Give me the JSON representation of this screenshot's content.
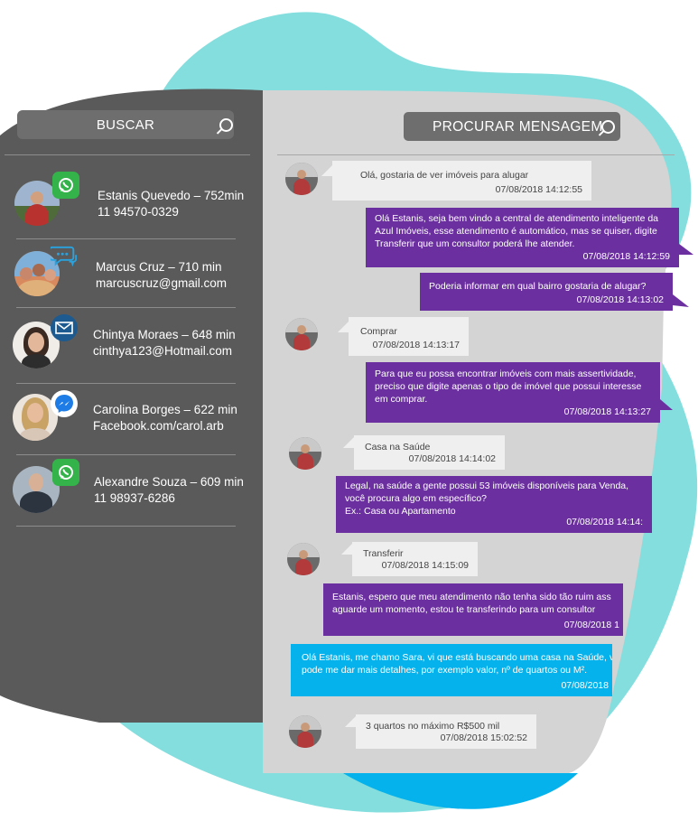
{
  "sidebar": {
    "search_label": "BUSCAR",
    "contacts": [
      {
        "name": "Estanis Quevedo – 752min",
        "detail": "11 94570-0329",
        "channel": "whatsapp-icon",
        "channel_color": "#34b34a"
      },
      {
        "name": "Marcus Cruz – 710 min",
        "detail": "marcuscruz@gmail.com",
        "channel": "chat-bubbles-icon",
        "channel_color": "#29a3e0"
      },
      {
        "name": "Chintya Moraes – 648 min",
        "detail": "cinthya123@Hotmail.com",
        "channel": "email-icon",
        "channel_color": "#1c5a8f"
      },
      {
        "name": "Carolina Borges – 622 min",
        "detail": "Facebook.com/carol.arb",
        "channel": "messenger-icon",
        "channel_color": "#1e7ce6"
      },
      {
        "name": "Alexandre Souza – 609 min",
        "detail": "11 98937-6286",
        "channel": "whatsapp-icon",
        "channel_color": "#34b34a"
      }
    ]
  },
  "chat": {
    "search_label": "PROCURAR MENSAGEM",
    "messages": [
      {
        "from": "customer",
        "text": "Olá, gostaria de ver imóveis para alugar",
        "time": "07/08/2018 14:12:55"
      },
      {
        "from": "bot",
        "text": "Olá Estanis, seja bem vindo a central de atendimento inteligente da Azul Imóveis, esse atendimento é automático, mas se quiser, digite Transferir que um consultor poderá lhe atender.",
        "time": "07/08/2018 14:12:59"
      },
      {
        "from": "bot",
        "text": "Poderia informar em qual bairro gostaria de alugar?",
        "time": "07/08/2018 14:13:02"
      },
      {
        "from": "customer",
        "text": "Comprar",
        "time": "07/08/2018 14:13:17"
      },
      {
        "from": "bot",
        "text": "Para que eu possa encontrar imóveis com mais assertividade, preciso que digite apenas o tipo de imóvel que possui interesse em comprar.",
        "time": "07/08/2018 14:13:27"
      },
      {
        "from": "customer",
        "text": "Casa na Saúde",
        "time": "07/08/2018 14:14:02"
      },
      {
        "from": "bot",
        "text": "Legal, na saúde a gente possui 53 imóveis disponíveis para Venda, você procura algo em específico?",
        "text2": "Ex.: Casa ou Apartamento",
        "time": "07/08/2018 14:14:"
      },
      {
        "from": "customer",
        "text": "Transferir",
        "time": "07/08/2018 14:15:09"
      },
      {
        "from": "bot",
        "text": "Estanis, espero que meu atendimento não tenha sido tão ruim ass",
        "text2": "aguarde um momento, estou te transferindo para um consultor",
        "time": "07/08/2018 1"
      },
      {
        "from": "agent",
        "text": "Olá Estanis, me chamo Sara, vi que está buscando uma casa na Saúde, v",
        "text2": "pode me dar mais detalhes, por exemplo valor, nº de quartos ou M².",
        "time": "07/08/2018"
      },
      {
        "from": "customer",
        "text": "3 quartos no máximo R$500 mil",
        "time": "07/08/2018 15:02:52"
      }
    ]
  },
  "colors": {
    "teal_blob": "#84dede",
    "dark_panel": "#5a5a5a",
    "chat_bg": "#d4d4d4",
    "bot_bubble": "#6b2fa0",
    "agent_bubble": "#05b2ec",
    "customer_bubble": "#efefef"
  }
}
